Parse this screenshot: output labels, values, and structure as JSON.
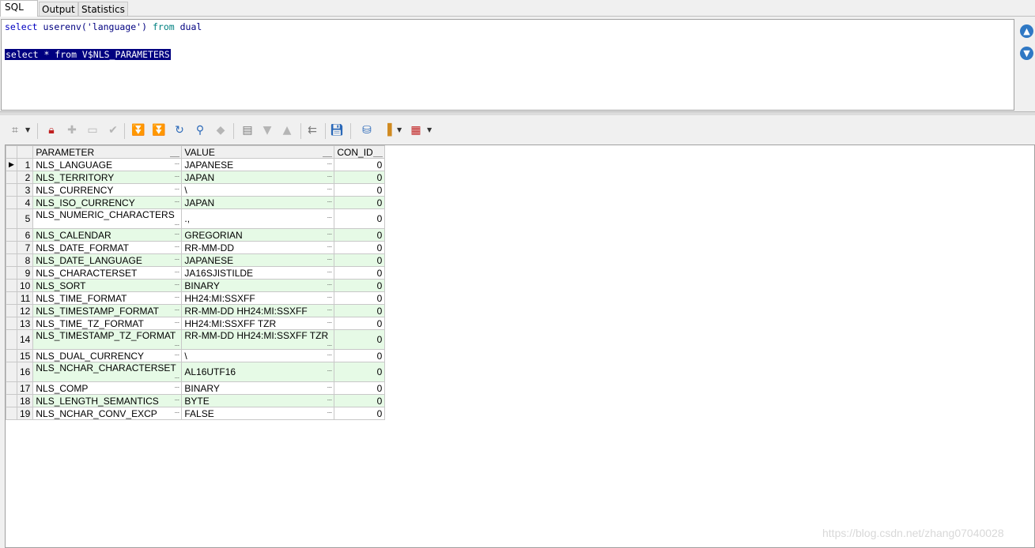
{
  "tabs": [
    {
      "label": "SQL",
      "active": true
    },
    {
      "label": "Output",
      "active": false
    },
    {
      "label": "Statistics",
      "active": false
    }
  ],
  "editor": {
    "line1": {
      "kw1": "select",
      "fn": " userenv(",
      "str": "'language'",
      "rest": ") ",
      "kw2": "from",
      "tbl": " dual"
    },
    "line2": "select * from V$NLS_PARAMETERS"
  },
  "toolbar_icons": [
    "query-builder-icon",
    "lock-icon",
    "insert-record-icon",
    "delete-record-icon",
    "post-changes-icon",
    "first-record-icon",
    "last-record-icon",
    "refresh-icon",
    "find-icon",
    "clear-icon",
    "single-record-view-icon",
    "previous-icon",
    "next-icon",
    "explain-icon",
    "save-icon",
    "export-icon",
    "chart-icon",
    "grid-view-icon"
  ],
  "grid": {
    "columns": [
      "PARAMETER",
      "VALUE",
      "CON_ID"
    ],
    "rows": [
      {
        "n": "1",
        "param": "NLS_LANGUAGE",
        "value": "JAPANESE",
        "con": "0"
      },
      {
        "n": "2",
        "param": "NLS_TERRITORY",
        "value": "JAPAN",
        "con": "0"
      },
      {
        "n": "3",
        "param": "NLS_CURRENCY",
        "value": "\\",
        "con": "0"
      },
      {
        "n": "4",
        "param": "NLS_ISO_CURRENCY",
        "value": "JAPAN",
        "con": "0"
      },
      {
        "n": "5",
        "param": "NLS_NUMERIC_CHARACTERS",
        "value": ".,",
        "con": "0"
      },
      {
        "n": "6",
        "param": "NLS_CALENDAR",
        "value": "GREGORIAN",
        "con": "0"
      },
      {
        "n": "7",
        "param": "NLS_DATE_FORMAT",
        "value": "RR-MM-DD",
        "con": "0"
      },
      {
        "n": "8",
        "param": "NLS_DATE_LANGUAGE",
        "value": "JAPANESE",
        "con": "0"
      },
      {
        "n": "9",
        "param": "NLS_CHARACTERSET",
        "value": "JA16SJISTILDE",
        "con": "0"
      },
      {
        "n": "10",
        "param": "NLS_SORT",
        "value": "BINARY",
        "con": "0"
      },
      {
        "n": "11",
        "param": "NLS_TIME_FORMAT",
        "value": "HH24:MI:SSXFF",
        "con": "0"
      },
      {
        "n": "12",
        "param": "NLS_TIMESTAMP_FORMAT",
        "value": "RR-MM-DD HH24:MI:SSXFF",
        "con": "0"
      },
      {
        "n": "13",
        "param": "NLS_TIME_TZ_FORMAT",
        "value": "HH24:MI:SSXFF TZR",
        "con": "0"
      },
      {
        "n": "14",
        "param": "NLS_TIMESTAMP_TZ_FORMAT",
        "value": "RR-MM-DD HH24:MI:SSXFF TZR",
        "con": "0"
      },
      {
        "n": "15",
        "param": "NLS_DUAL_CURRENCY",
        "value": "\\",
        "con": "0"
      },
      {
        "n": "16",
        "param": "NLS_NCHAR_CHARACTERSET",
        "value": "AL16UTF16",
        "con": "0"
      },
      {
        "n": "17",
        "param": "NLS_COMP",
        "value": "BINARY",
        "con": "0"
      },
      {
        "n": "18",
        "param": "NLS_LENGTH_SEMANTICS",
        "value": "BYTE",
        "con": "0"
      },
      {
        "n": "19",
        "param": "NLS_NCHAR_CONV_EXCP",
        "value": "FALSE",
        "con": "0"
      }
    ]
  },
  "watermark": "https://blog.csdn.net/zhang07040028"
}
